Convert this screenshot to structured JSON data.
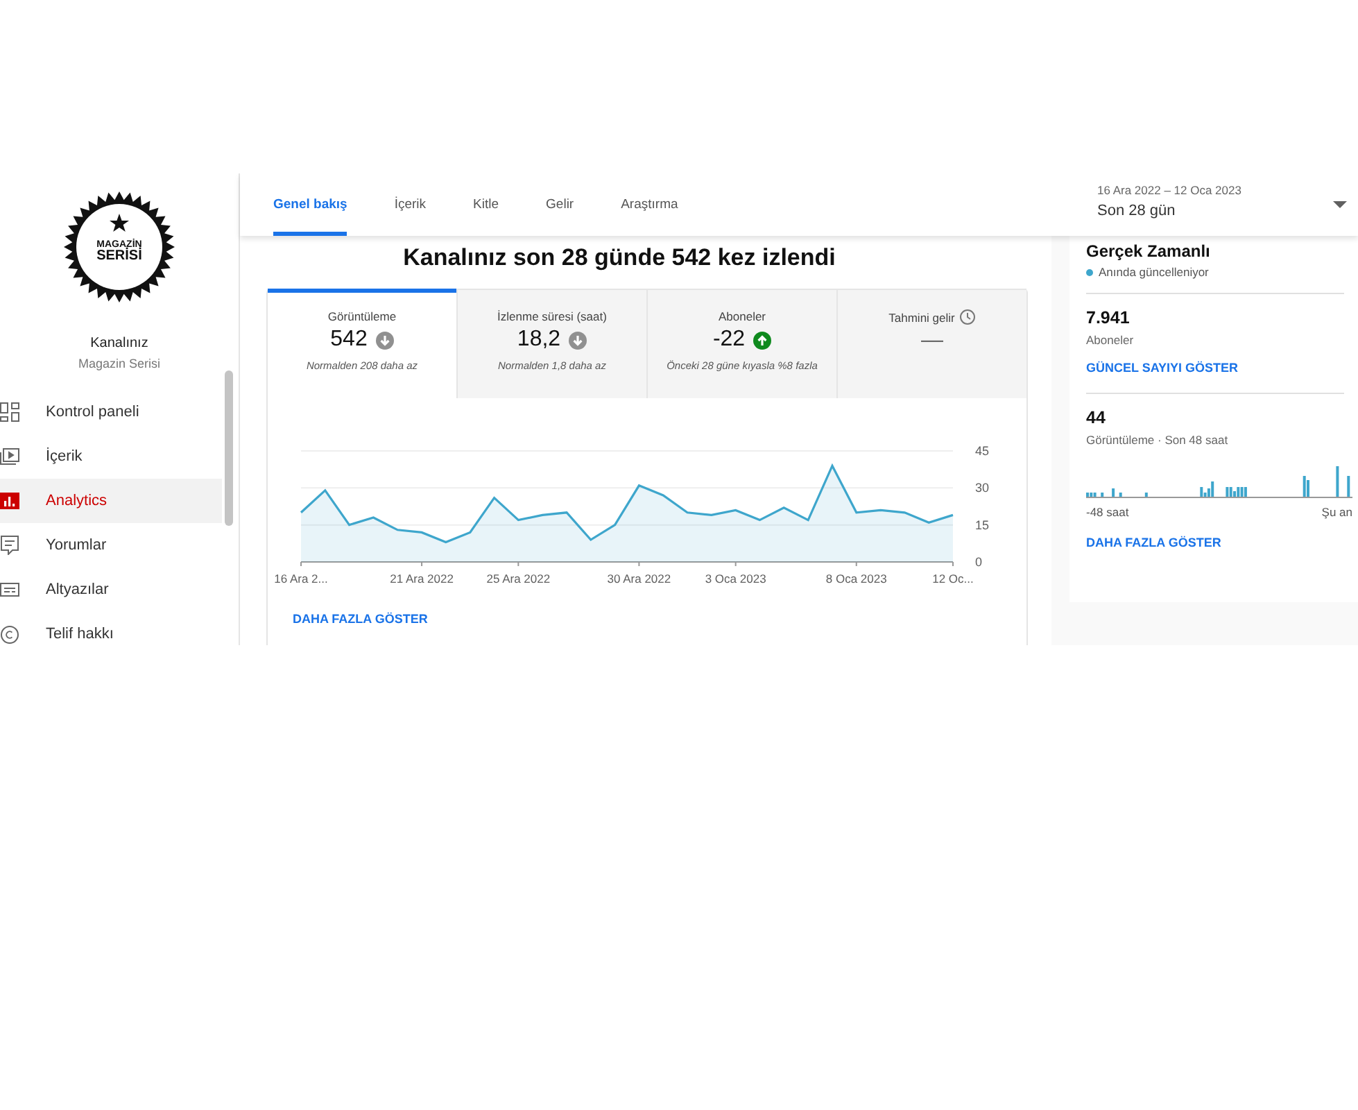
{
  "channel": {
    "logo_lines": [
      "MAGAZİN",
      "SERİSİ"
    ],
    "title": "Kanalınız",
    "name": "Magazin Serisi"
  },
  "sidebar": {
    "items": [
      {
        "label": "Kontrol paneli",
        "selected": false
      },
      {
        "label": "İçerik",
        "selected": false
      },
      {
        "label": "Analytics",
        "selected": true
      },
      {
        "label": "Yorumlar",
        "selected": false
      },
      {
        "label": "Altyazılar",
        "selected": false
      },
      {
        "label": "Telif hakkı",
        "selected": false
      }
    ]
  },
  "tabs": [
    {
      "label": "Genel bakış",
      "selected": true
    },
    {
      "label": "İçerik",
      "selected": false
    },
    {
      "label": "Kitle",
      "selected": false
    },
    {
      "label": "Gelir",
      "selected": false
    },
    {
      "label": "Araştırma",
      "selected": false
    }
  ],
  "date_range": {
    "range": "16 Ara 2022 – 12 Oca 2023",
    "period": "Son 28 gün"
  },
  "headline": "Kanalınız son 28 günde 542 kez izlendi",
  "metrics": [
    {
      "label": "Görüntüleme",
      "value": "542",
      "kind": "down",
      "note": "Normalden 208 daha az",
      "selected": true
    },
    {
      "label": "İzlenme süresi (saat)",
      "value": "18,2",
      "kind": "down",
      "note": "Normalden 1,8 daha az",
      "selected": false
    },
    {
      "label": "Aboneler",
      "value": "-22",
      "kind": "up",
      "note": "Önceki 28 güne kıyasla %8 fazla",
      "selected": false
    },
    {
      "label": "Tahmini gelir",
      "value": "—",
      "kind": "plain",
      "info": true,
      "selected": false
    }
  ],
  "chart_data": {
    "type": "area",
    "categories": [
      "16 Ara 2...",
      null,
      null,
      null,
      null,
      "21 Ara 2022",
      null,
      null,
      null,
      "25 Ara 2022",
      null,
      null,
      null,
      null,
      "30 Ara 2022",
      null,
      null,
      null,
      "3 Oca 2023",
      null,
      null,
      null,
      null,
      "8 Oca 2023",
      null,
      null,
      null,
      "12 Oc..."
    ],
    "series": [
      {
        "color": "#3ea6cc",
        "values": [
          20,
          29,
          15,
          18,
          13,
          12,
          8,
          12,
          26,
          17,
          19,
          20,
          9,
          15,
          31,
          27,
          20,
          19,
          21,
          17,
          22,
          17,
          39,
          20,
          21,
          20,
          16,
          19
        ]
      }
    ],
    "ylim": [
      0,
      45
    ],
    "yticks": [
      0,
      15,
      30,
      45
    ]
  },
  "more_link": "DAHA FAZLA GÖSTER",
  "realtime": {
    "title": "Gerçek Zamanlı",
    "status": "Anında güncelleniyor",
    "subscribers": "7.941",
    "subscribers_label": "Aboneler",
    "subscribers_link": "GÜNCEL SAYIYI GÖSTER",
    "views": "44",
    "views_label": "Görüntüleme · Son 48 saat",
    "axis_start": "-48 saat",
    "axis_end": "Şu an",
    "more_link": "DAHA FAZLA GÖSTER"
  }
}
